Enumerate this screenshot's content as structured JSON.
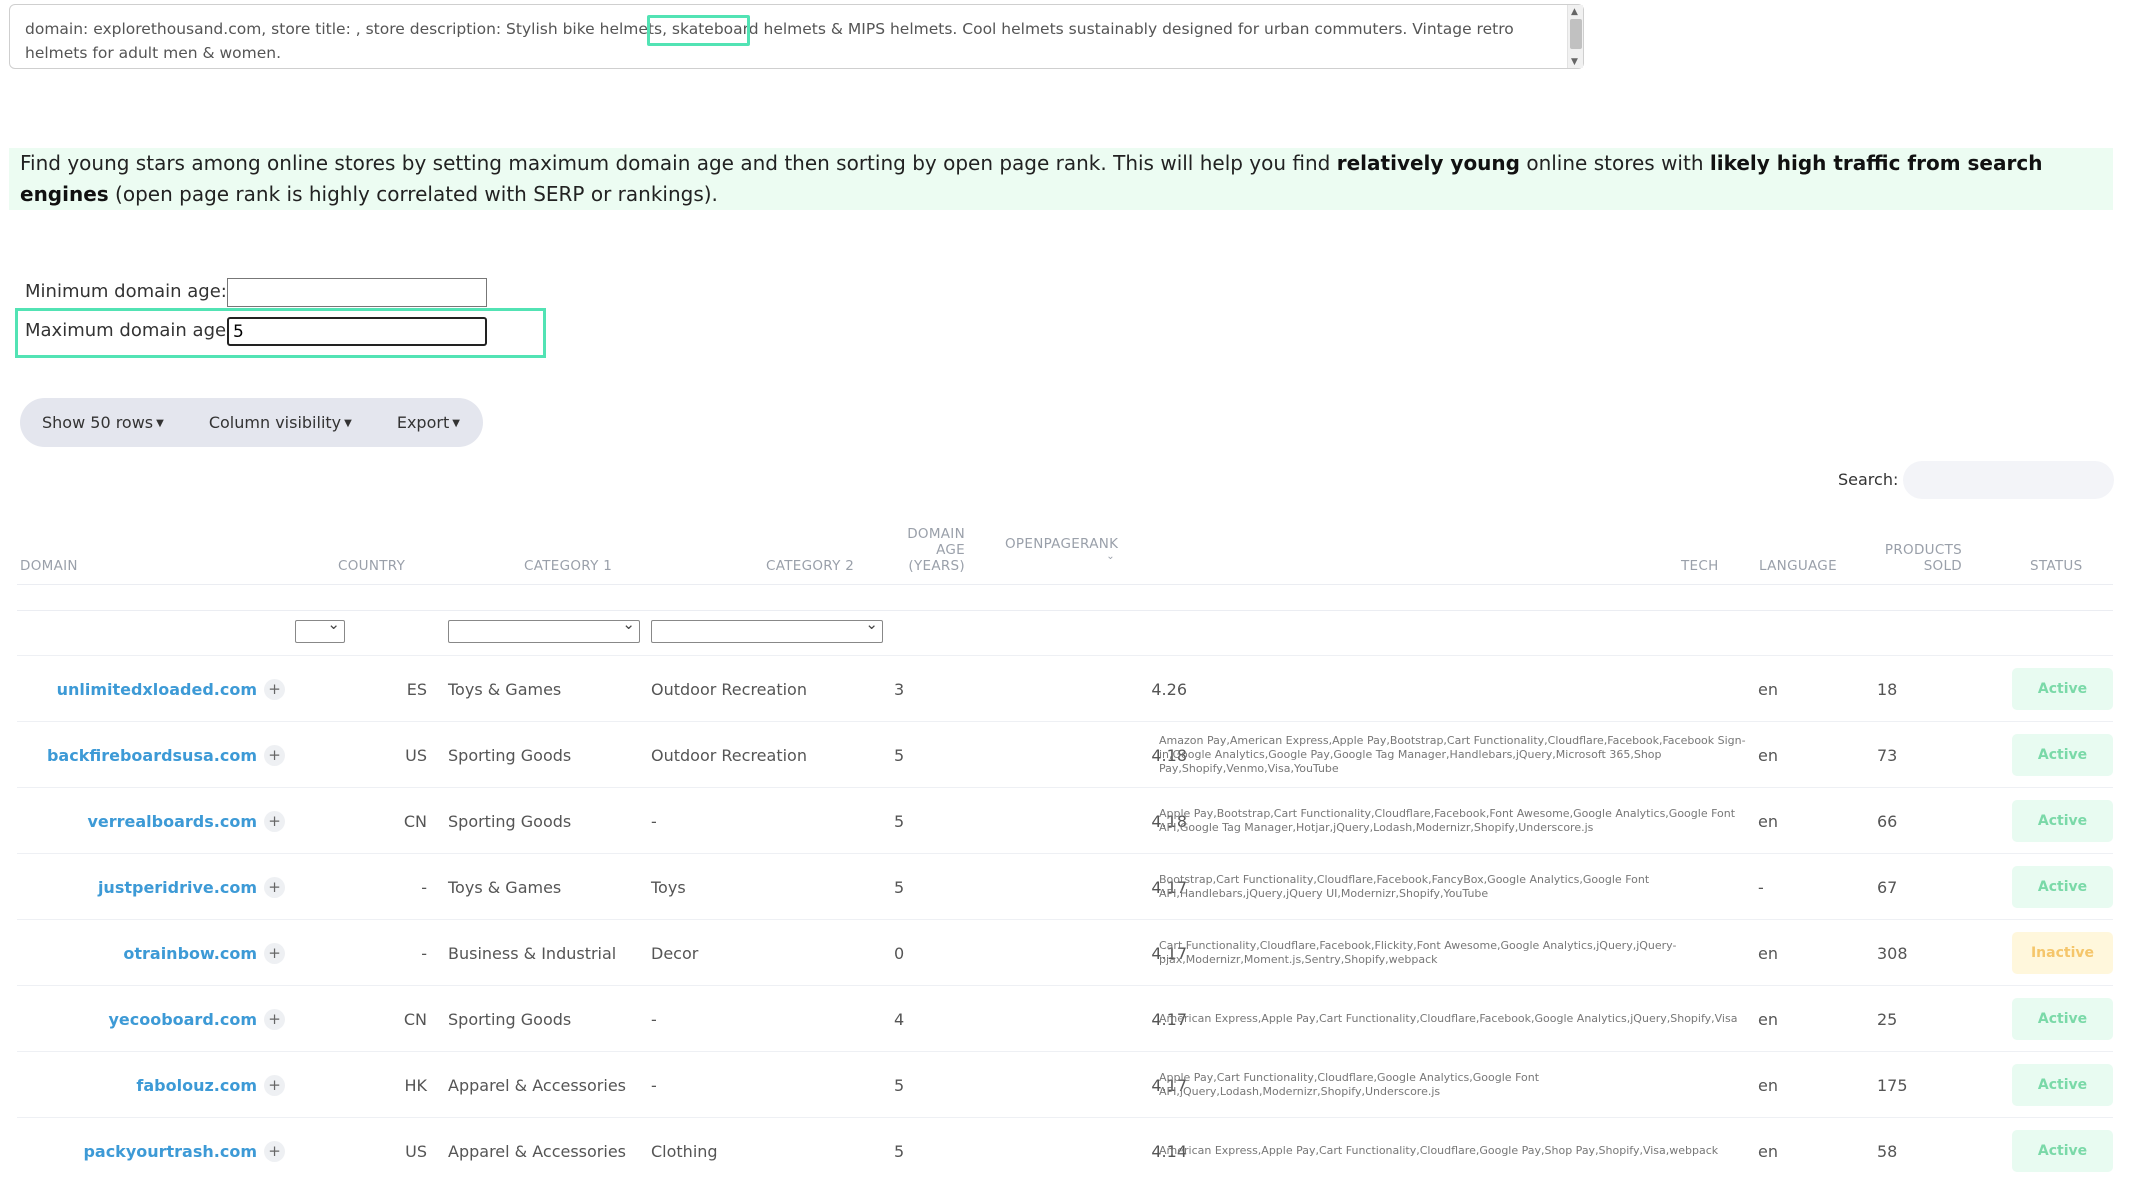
{
  "description": {
    "text_line1": "domain: explorethousand.com, store title: , store description: Stylish bike helmets, skateboard helmets & MIPS helmets. Cool helmets sustainably designed for urban commuters. Vintage retro",
    "text_line2": "helmets for adult men & women."
  },
  "info": {
    "part1": "Find young stars among online stores by setting maximum domain age and then sorting by open page rank. This will help you find ",
    "bold1": "relatively young",
    "part2": " online stores with ",
    "bold2": "likely high traffic from search engines",
    "part3": " (open page rank is highly correlated with SERP or rankings)."
  },
  "filters": {
    "min_label": "Minimum domain age:",
    "min_value": "",
    "max_label": "Maximum domain age:",
    "max_value": "5"
  },
  "toolbar": {
    "show_rows": "Show 50 rows",
    "column_visibility": "Column visibility",
    "export": "Export",
    "search_label": "Search:"
  },
  "columns": {
    "domain": "DOMAIN",
    "country": "COUNTRY",
    "category1": "CATEGORY 1",
    "category2": "CATEGORY 2",
    "age_1": "DOMAIN",
    "age_2": "AGE",
    "age_3": "(YEARS)",
    "rank": "OPENPAGERANK",
    "tech": "TECH",
    "language": "LANGUAGE",
    "sold_1": "PRODUCTS",
    "sold_2": "SOLD",
    "status": "STATUS"
  },
  "rows": [
    {
      "domain": "unlimitedxloaded.com",
      "country": "ES",
      "cat1": "Toys & Games",
      "cat2": "Outdoor Recreation",
      "age": "3",
      "rank": "4.26",
      "tech": "",
      "lang": "en",
      "sold": "18",
      "status": "Active"
    },
    {
      "domain": "backfireboardsusa.com",
      "country": "US",
      "cat1": "Sporting Goods",
      "cat2": "Outdoor Recreation",
      "age": "5",
      "rank": "4.18",
      "tech": "Amazon Pay,American Express,Apple Pay,Bootstrap,Cart Functionality,Cloudflare,Facebook,Facebook Sign-in,Google Analytics,Google Pay,Google Tag Manager,Handlebars,jQuery,Microsoft 365,Shop Pay,Shopify,Venmo,Visa,YouTube",
      "lang": "en",
      "sold": "73",
      "status": "Active"
    },
    {
      "domain": "verrealboards.com",
      "country": "CN",
      "cat1": "Sporting Goods",
      "cat2": "-",
      "age": "5",
      "rank": "4.18",
      "tech": "Apple Pay,Bootstrap,Cart Functionality,Cloudflare,Facebook,Font Awesome,Google Analytics,Google Font API,Google Tag Manager,Hotjar,jQuery,Lodash,Modernizr,Shopify,Underscore.js",
      "lang": "en",
      "sold": "66",
      "status": "Active"
    },
    {
      "domain": "justperidrive.com",
      "country": "-",
      "cat1": "Toys & Games",
      "cat2": "Toys",
      "age": "5",
      "rank": "4.17",
      "tech": "Bootstrap,Cart Functionality,Cloudflare,Facebook,FancyBox,Google Analytics,Google Font API,Handlebars,jQuery,jQuery UI,Modernizr,Shopify,YouTube",
      "lang": "-",
      "sold": "67",
      "status": "Active"
    },
    {
      "domain": "otrainbow.com",
      "country": "-",
      "cat1": "Business & Industrial",
      "cat2": "Decor",
      "age": "0",
      "rank": "4.17",
      "tech": "Cart Functionality,Cloudflare,Facebook,Flickity,Font Awesome,Google Analytics,jQuery,jQuery-pjax,Modernizr,Moment.js,Sentry,Shopify,webpack",
      "lang": "en",
      "sold": "308",
      "status": "Inactive"
    },
    {
      "domain": "yecooboard.com",
      "country": "CN",
      "cat1": "Sporting Goods",
      "cat2": "-",
      "age": "4",
      "rank": "4.17",
      "tech": "American Express,Apple Pay,Cart Functionality,Cloudflare,Facebook,Google Analytics,jQuery,Shopify,Visa",
      "lang": "en",
      "sold": "25",
      "status": "Active"
    },
    {
      "domain": "fabolouz.com",
      "country": "HK",
      "cat1": "Apparel & Accessories",
      "cat2": "-",
      "age": "5",
      "rank": "4.17",
      "tech": "Apple Pay,Cart Functionality,Cloudflare,Google Analytics,Google Font API,jQuery,Lodash,Modernizr,Shopify,Underscore.js",
      "lang": "en",
      "sold": "175",
      "status": "Active"
    },
    {
      "domain": "packyourtrash.com",
      "country": "US",
      "cat1": "Apparel & Accessories",
      "cat2": "Clothing",
      "age": "5",
      "rank": "4.14",
      "tech": "American Express,Apple Pay,Cart Functionality,Cloudflare,Google Pay,Shop Pay,Shopify,Visa,webpack",
      "lang": "en",
      "sold": "58",
      "status": "Active"
    }
  ]
}
